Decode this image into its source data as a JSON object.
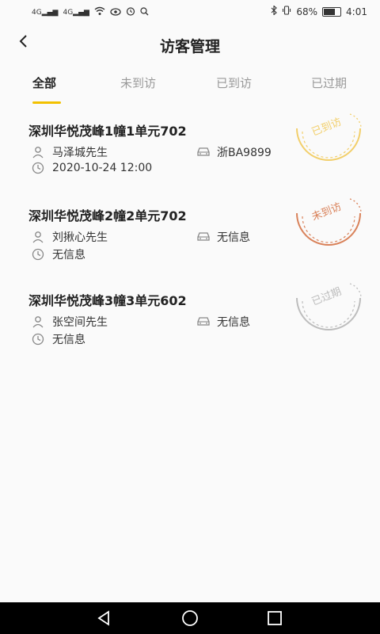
{
  "status_bar": {
    "signal1": "4G",
    "signal2": "4G",
    "battery_percent": "68%",
    "battery_level": 0.68,
    "time": "4:01"
  },
  "header": {
    "title": "访客管理"
  },
  "tabs": [
    {
      "label": "全部",
      "active": true
    },
    {
      "label": "未到访",
      "active": false
    },
    {
      "label": "已到访",
      "active": false
    },
    {
      "label": "已过期",
      "active": false
    }
  ],
  "visitors": [
    {
      "address": "深圳华悦茂峰1幢1单元702",
      "visitor_name": "马泽城先生",
      "plate": "浙BA9899",
      "time": "2020-10-24 12:00",
      "stamp_label": "已到访",
      "stamp_color": "#f2cf6b"
    },
    {
      "address": "深圳华悦茂峰2幢2单元702",
      "visitor_name": "刘揪心先生",
      "plate": "无信息",
      "time": "无信息",
      "stamp_label": "未到访",
      "stamp_color": "#d9825a"
    },
    {
      "address": "深圳华悦茂峰3幢3单元602",
      "visitor_name": "张空间先生",
      "plate": "无信息",
      "time": "无信息",
      "stamp_label": "已过期",
      "stamp_color": "#bdbdbd"
    }
  ],
  "colors": {
    "accent": "#f2c100"
  },
  "icons": {
    "person": "person-icon",
    "car": "car-icon",
    "clock": "clock-icon"
  }
}
